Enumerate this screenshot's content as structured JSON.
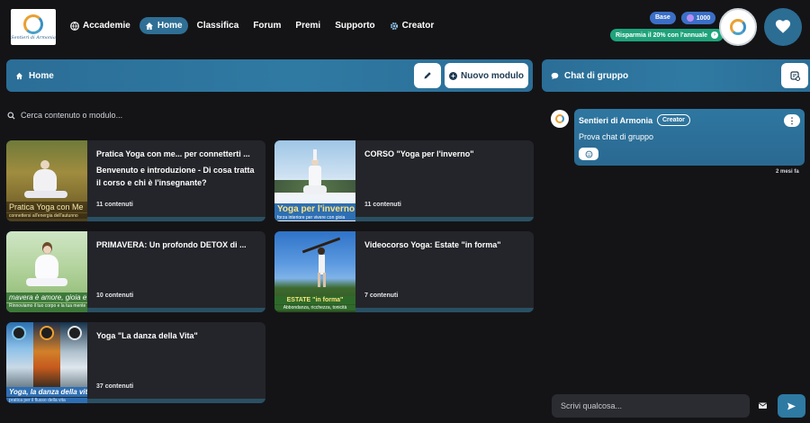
{
  "brand": {
    "logo_text": "Sentieri di Armonia"
  },
  "nav": {
    "items": [
      {
        "label": "Accademie",
        "icon": "globe-icon"
      },
      {
        "label": "Home",
        "icon": "home-icon",
        "active": true
      },
      {
        "label": "Classifica"
      },
      {
        "label": "Forum"
      },
      {
        "label": "Premi"
      },
      {
        "label": "Supporto"
      },
      {
        "label": "Creator",
        "icon": "gear-icon"
      }
    ]
  },
  "account": {
    "plan": "Base",
    "points": "1000",
    "promo": "Risparmia il 20% con l'annuale",
    "brand_color": "#2c6d94",
    "promo_color": "#1fa37a"
  },
  "home": {
    "title": "Home",
    "new_module_label": "Nuovo modulo",
    "search_placeholder": "Cerca contenuto o modulo..."
  },
  "modules": [
    {
      "title": "Pratica Yoga con me... per connetterti ...",
      "description": "Benvenuto e introduzione - Di cosa tratta il corso e chi è l'insegnante?",
      "count": "11 contenuti",
      "thumb_caption": "Pratica Yoga con Me",
      "thumb_subcaption": "connettersi all'energia dell'autunno"
    },
    {
      "title": "CORSO \"Yoga per l'inverno\"",
      "description": "",
      "count": "11 contenuti",
      "thumb_caption": "Yoga per l'inverno",
      "thumb_subcaption": "forza interiore per vivere con gioia"
    },
    {
      "title": "PRIMAVERA: Un profondo DETOX di ...",
      "description": "",
      "count": "10 contenuti",
      "thumb_caption": "mavera è amore, gioia e leggere",
      "thumb_subcaption": "Rinnoviamo il tuo corpo e la tua mente"
    },
    {
      "title": "Videocorso Yoga:  Estate \"in forma\"",
      "description": "",
      "count": "7 contenuti",
      "thumb_caption": "ESTATE \"in forma\"",
      "thumb_subcaption": "Abbondanza, ricchezza, tonicità"
    },
    {
      "title": "Yoga \"La danza della Vita\"",
      "description": "",
      "count": "37 contenuti",
      "thumb_caption": "Yoga, la danza della vita",
      "thumb_subcaption": "pratica per il flusso della vita"
    }
  ],
  "chat": {
    "title": "Chat di gruppo",
    "message": {
      "author": "Sentieri di Armonia",
      "role": "Creator",
      "text": "Prova chat di gruppo",
      "time": "2 mesi fa"
    },
    "input_placeholder": "Scrivi qualcosa..."
  }
}
